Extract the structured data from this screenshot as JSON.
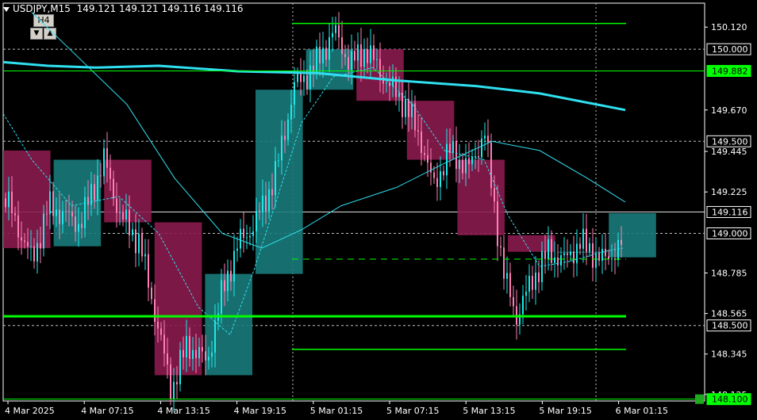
{
  "header": {
    "symbol": "USDJPY,M15",
    "ohlc": "149.121 149.121 149.116 149.116"
  },
  "timeframe_widget": {
    "label": "H4",
    "down_arrow": "▼",
    "up_arrow": "▲"
  },
  "colors": {
    "background": "#000000",
    "bull_candle": "#1de9e9",
    "bear_candle": "#ff7fb6",
    "bull_box": "#1a7a7a",
    "bear_box": "#8a1b4d",
    "green_level": "#00ff00",
    "ma_slow": "#2fe0f0",
    "ma_fast": "#2fe0f0",
    "grid": "#c0c0c0"
  },
  "price_axis": {
    "labels": [
      "150.120",
      "149.670",
      "149.445",
      "149.225",
      "148.785",
      "148.565",
      "148.345",
      "148.125"
    ],
    "boxed": [
      {
        "text": "150.000",
        "style": "white"
      },
      {
        "text": "149.882",
        "style": "green"
      },
      {
        "text": "149.500",
        "style": "white"
      },
      {
        "text": "149.116",
        "style": "white"
      },
      {
        "text": "149.000",
        "style": "white"
      },
      {
        "text": "148.500",
        "style": "white"
      },
      {
        "text": "148.100",
        "style": "green"
      }
    ]
  },
  "time_axis": [
    "4 Mar 2025",
    "4 Mar 07:15",
    "4 Mar 13:15",
    "4 Mar 19:15",
    "5 Mar 01:15",
    "5 Mar 07:15",
    "5 Mar 13:15",
    "5 Mar 19:15",
    "6 Mar 01:15"
  ],
  "chart_data": {
    "type": "candlestick",
    "symbol": "USDJPY",
    "timeframe": "M15",
    "ylim": [
      148.09,
      150.25
    ],
    "horizontal_levels": [
      150.0,
      149.882,
      149.5,
      149.116,
      149.0,
      148.5,
      148.1
    ],
    "green_levels": [
      150.14,
      149.882,
      148.86,
      148.55,
      148.37,
      148.1
    ],
    "h4_boxes": [
      {
        "open": 149.45,
        "close": 148.92,
        "dir": "bear"
      },
      {
        "open": 148.93,
        "close": 149.4,
        "dir": "bull"
      },
      {
        "open": 149.4,
        "close": 149.06,
        "dir": "bear"
      },
      {
        "open": 149.06,
        "close": 148.23,
        "dir": "bear"
      },
      {
        "open": 148.23,
        "close": 148.78,
        "dir": "bull"
      },
      {
        "open": 148.78,
        "close": 149.78,
        "dir": "bull"
      },
      {
        "open": 149.78,
        "close": 150.0,
        "dir": "bull"
      },
      {
        "open": 150.0,
        "close": 149.72,
        "dir": "bear"
      },
      {
        "open": 149.72,
        "close": 149.4,
        "dir": "bear"
      },
      {
        "open": 149.4,
        "close": 148.99,
        "dir": "bear"
      },
      {
        "open": 148.99,
        "close": 148.9,
        "dir": "bear"
      },
      {
        "open": 148.9,
        "close": 148.9,
        "dir": "bull"
      },
      {
        "open": 148.87,
        "close": 149.11,
        "dir": "bull"
      }
    ]
  }
}
